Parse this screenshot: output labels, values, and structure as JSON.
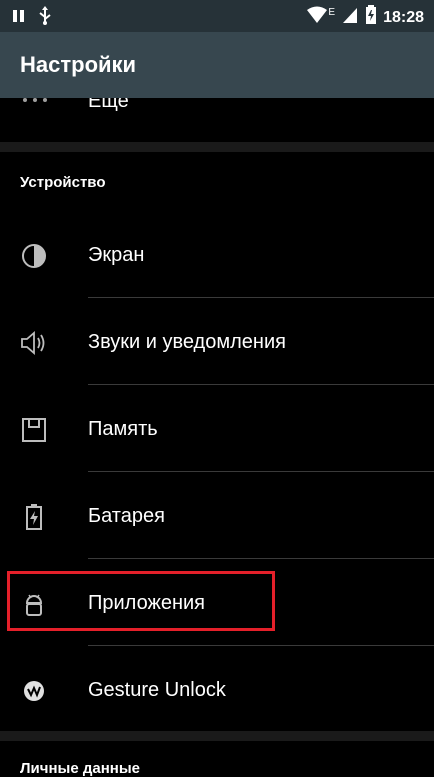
{
  "status_bar": {
    "time": "18:28",
    "network_letter": "E",
    "colors": {
      "background": "#263238"
    }
  },
  "toolbar": {
    "title": "Настройки",
    "colors": {
      "background": "#37474f"
    }
  },
  "partial_item": {
    "label": "Еще",
    "icon": "more-dots-icon"
  },
  "device_section": {
    "header": "Устройство",
    "items": [
      {
        "label": "Экран",
        "icon": "display-brightness-icon"
      },
      {
        "label": "Звуки и уведомления",
        "icon": "speaker-icon"
      },
      {
        "label": "Память",
        "icon": "storage-icon"
      },
      {
        "label": "Батарея",
        "icon": "battery-charging-icon"
      },
      {
        "label": "Приложения",
        "icon": "android-apps-icon"
      },
      {
        "label": "Gesture Unlock",
        "icon": "gesture-unlock-icon"
      }
    ]
  },
  "personal_section": {
    "header": "Личные данные"
  },
  "highlight": {
    "color": "#e5202a"
  }
}
